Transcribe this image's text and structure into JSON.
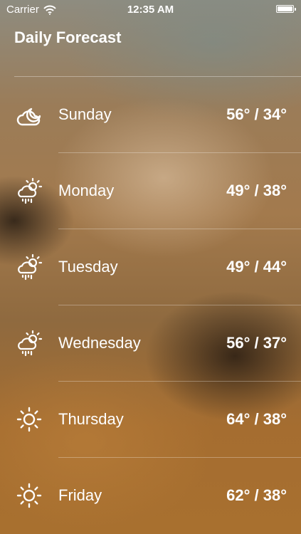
{
  "status_bar": {
    "carrier": "Carrier",
    "time": "12:35 AM",
    "battery_level": 1.0
  },
  "header": {
    "title": "Daily Forecast"
  },
  "forecast": [
    {
      "day": "Sunday",
      "temps": "56° / 34°",
      "icon": "partly-cloudy-night-icon"
    },
    {
      "day": "Monday",
      "temps": "49° / 38°",
      "icon": "rain-sun-icon"
    },
    {
      "day": "Tuesday",
      "temps": "49° / 44°",
      "icon": "rain-sun-icon"
    },
    {
      "day": "Wednesday",
      "temps": "56° / 37°",
      "icon": "rain-sun-icon"
    },
    {
      "day": "Thursday",
      "temps": "64° / 38°",
      "icon": "sun-icon"
    },
    {
      "day": "Friday",
      "temps": "62° / 38°",
      "icon": "sun-icon"
    }
  ]
}
